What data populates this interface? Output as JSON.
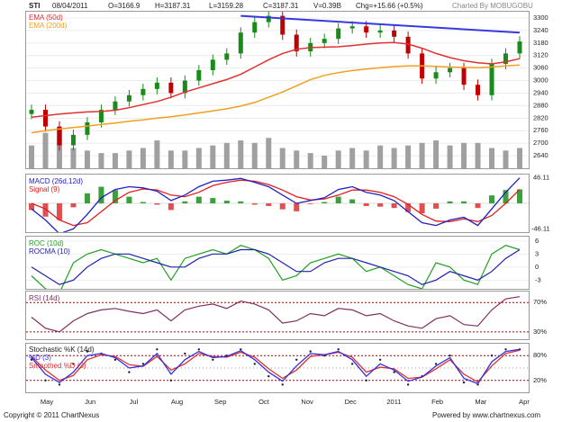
{
  "header": {
    "symbol": "STI",
    "date": "08/04/2011",
    "open": "O=3166.9",
    "high": "H=3187.31",
    "low": "L=3159.28",
    "close": "C=3187.31",
    "volume": "V=0.39B",
    "change": "Chg=+15.66 (+0.5%)",
    "charted_by": "Charted By MOBUGOBU"
  },
  "footer": {
    "copyright": "Copyright © 2011 ChartNexus",
    "powered": "Powered by www.chartnexus.com"
  },
  "colors": {
    "price_up": "#1a8a1a",
    "price_down": "#c00000",
    "ema50": "#e03030",
    "ema200": "#f0a020",
    "trendline": "#3838e0",
    "volume": "#a0a0a0",
    "macd": "#2020c0",
    "signal": "#e02020",
    "roc": "#20a020",
    "rocma": "#2020b0",
    "rsi": "#803060",
    "stoch_k": "#202020",
    "stoch_d": "#3030e0",
    "stoch_sd": "#e03030",
    "ref_line": "#b00000"
  },
  "chart_data": [
    {
      "type": "candlestick",
      "series": [
        {
          "name": "EMA (50d)",
          "values": [
            2825,
            2832,
            2840,
            2845,
            2850,
            2852,
            2858,
            2870,
            2885,
            2900,
            2920,
            2945,
            2965,
            2985,
            3005,
            3030,
            3065,
            3100,
            3130,
            3150,
            3158,
            3160,
            3162,
            3168,
            3175,
            3180,
            3182,
            3175,
            3155,
            3130,
            3110,
            3095,
            3085,
            3080,
            3090,
            3105
          ]
        },
        {
          "name": "EMA (200d)",
          "values": [
            2750,
            2760,
            2768,
            2775,
            2782,
            2790,
            2797,
            2805,
            2812,
            2820,
            2827,
            2835,
            2845,
            2855,
            2865,
            2878,
            2895,
            2920,
            2945,
            2975,
            3005,
            3025,
            3038,
            3048,
            3055,
            3062,
            3067,
            3070,
            3070,
            3068,
            3065,
            3063,
            3062,
            3065,
            3070,
            3075
          ]
        },
        {
          "name": "Close",
          "values": [
            2860,
            2780,
            2690,
            2740,
            2800,
            2860,
            2900,
            2930,
            2960,
            2990,
            2940,
            3000,
            3050,
            3100,
            3130,
            3230,
            3280,
            3310,
            3220,
            3140,
            3180,
            3200,
            3250,
            3260,
            3230,
            3240,
            3210,
            3130,
            3010,
            3040,
            3060,
            2980,
            2930,
            3080,
            3130,
            3187.31
          ]
        }
      ],
      "x": [
        "2010-04-16",
        "2010-04-30",
        "2010-05-14",
        "2010-05-28",
        "2010-06-11",
        "2010-06-25",
        "2010-07-09",
        "2010-07-23",
        "2010-08-06",
        "2010-08-20",
        "2010-09-03",
        "2010-09-17",
        "2010-10-01",
        "2010-10-15",
        "2010-10-29",
        "2010-11-05",
        "2010-11-12",
        "2010-11-19",
        "2010-11-26",
        "2010-12-03",
        "2010-12-17",
        "2010-12-31",
        "2011-01-07",
        "2011-01-14",
        "2011-01-21",
        "2011-01-28",
        "2011-02-04",
        "2011-02-11",
        "2011-02-18",
        "2011-02-25",
        "2011-03-04",
        "2011-03-11",
        "2011-03-18",
        "2011-03-25",
        "2011-04-01",
        "2011-04-08"
      ],
      "trendline": {
        "from": [
          "2010-11-05",
          3310
        ],
        "to": [
          "2011-04-08",
          3230
        ]
      },
      "yticks": [
        3300,
        3240,
        3180,
        3120,
        3060,
        3000,
        2940,
        2880,
        2820,
        2760,
        2700,
        2640
      ],
      "ylim": [
        2580,
        3330
      ],
      "xlabels": [
        "May",
        "Jun",
        "Jul",
        "Aug",
        "Sep",
        "Oct",
        "Nov",
        "Dec",
        "2011",
        "Feb",
        "Mar",
        "Apr"
      ],
      "legend": [
        "EMA (50d)",
        "EMA (200d)"
      ]
    },
    {
      "type": "bar",
      "name": "Volume",
      "values": [
        0.9,
        1.4,
        1.6,
        0.8,
        0.7,
        0.6,
        0.6,
        0.7,
        0.8,
        1.1,
        0.7,
        0.7,
        0.8,
        0.9,
        1.0,
        1.1,
        1.0,
        1.2,
        0.8,
        0.7,
        0.6,
        0.5,
        0.7,
        0.8,
        0.7,
        0.9,
        0.8,
        0.9,
        1.0,
        1.1,
        0.9,
        1.0,
        1.0,
        0.8,
        0.7,
        0.8
      ]
    },
    {
      "type": "line",
      "title": "MACD (26d,12d)",
      "series": [
        {
          "name": "MACD (26d,12d)",
          "values": [
            -10,
            -30,
            -55,
            -46,
            -20,
            10,
            25,
            30,
            28,
            22,
            5,
            15,
            30,
            40,
            42,
            45,
            38,
            30,
            15,
            0,
            5,
            10,
            25,
            30,
            20,
            15,
            5,
            -15,
            -35,
            -40,
            -30,
            -25,
            -40,
            -10,
            20,
            46
          ]
        },
        {
          "name": "Signal (9)",
          "values": [
            0,
            -10,
            -30,
            -40,
            -35,
            -15,
            5,
            20,
            26,
            24,
            15,
            12,
            20,
            32,
            38,
            42,
            40,
            34,
            24,
            12,
            6,
            8,
            15,
            24,
            24,
            20,
            12,
            -2,
            -20,
            -32,
            -33,
            -28,
            -33,
            -22,
            0,
            25
          ]
        }
      ],
      "ylim": [
        -52,
        52
      ],
      "ytick_labels": [
        "46.11",
        "-46.11"
      ]
    },
    {
      "type": "line",
      "series": [
        {
          "name": "ROC (10d)",
          "values": [
            -2,
            -5,
            -6,
            1,
            3,
            4,
            3,
            2,
            1,
            2,
            -3,
            2,
            3,
            4,
            3,
            5,
            4,
            2,
            -3,
            -2,
            1,
            2,
            3,
            2,
            -1,
            0,
            -2,
            -4,
            -5,
            1,
            0,
            -3,
            -4,
            3,
            5,
            4
          ]
        },
        {
          "name": "ROCMA (10)",
          "values": [
            0,
            -2,
            -4,
            -3,
            0,
            2,
            3,
            3,
            2,
            1,
            0,
            0,
            2,
            3,
            3,
            4,
            4,
            3,
            1,
            -1,
            -1,
            1,
            2,
            2,
            1,
            0,
            -1,
            -2,
            -4,
            -3,
            -1,
            -2,
            -3,
            -1,
            2,
            4
          ]
        }
      ],
      "ylim": [
        -5,
        7
      ],
      "yticks": [
        6,
        3,
        0,
        -3
      ]
    },
    {
      "type": "line",
      "series": [
        {
          "name": "RSI (14d)",
          "values": [
            50,
            35,
            30,
            45,
            55,
            60,
            62,
            58,
            55,
            60,
            45,
            60,
            65,
            68,
            62,
            72,
            68,
            60,
            42,
            45,
            55,
            52,
            62,
            60,
            52,
            55,
            45,
            38,
            35,
            48,
            52,
            40,
            38,
            60,
            75,
            78
          ]
        }
      ],
      "ylim": [
        20,
        85
      ],
      "ref_lines": [
        70,
        30
      ],
      "ytick_labels": [
        "70%",
        "30%"
      ]
    },
    {
      "type": "line",
      "series": [
        {
          "name": "Stochastic %K (14d)",
          "values": [
            70,
            20,
            10,
            60,
            90,
            85,
            70,
            40,
            60,
            95,
            20,
            85,
            95,
            70,
            80,
            95,
            60,
            30,
            10,
            70,
            90,
            80,
            95,
            60,
            20,
            70,
            40,
            10,
            30,
            60,
            80,
            15,
            10,
            80,
            95,
            95
          ]
        },
        {
          "name": "%D (3)",
          "values": [
            75,
            35,
            15,
            40,
            80,
            85,
            75,
            50,
            55,
            85,
            35,
            70,
            90,
            75,
            78,
            92,
            70,
            40,
            18,
            55,
            85,
            82,
            90,
            70,
            30,
            60,
            45,
            18,
            28,
            55,
            75,
            25,
            12,
            65,
            90,
            95
          ]
        },
        {
          "name": "Smoothed %D (3)",
          "values": [
            78,
            45,
            20,
            32,
            70,
            82,
            78,
            58,
            54,
            78,
            45,
            60,
            85,
            78,
            76,
            88,
            76,
            48,
            25,
            45,
            78,
            82,
            88,
            76,
            40,
            52,
            48,
            25,
            28,
            48,
            70,
            35,
            16,
            55,
            85,
            93
          ]
        }
      ],
      "ylim": [
        0,
        100
      ],
      "ref_lines": [
        80,
        20
      ],
      "ytick_labels": [
        "80%",
        "20%"
      ]
    }
  ]
}
